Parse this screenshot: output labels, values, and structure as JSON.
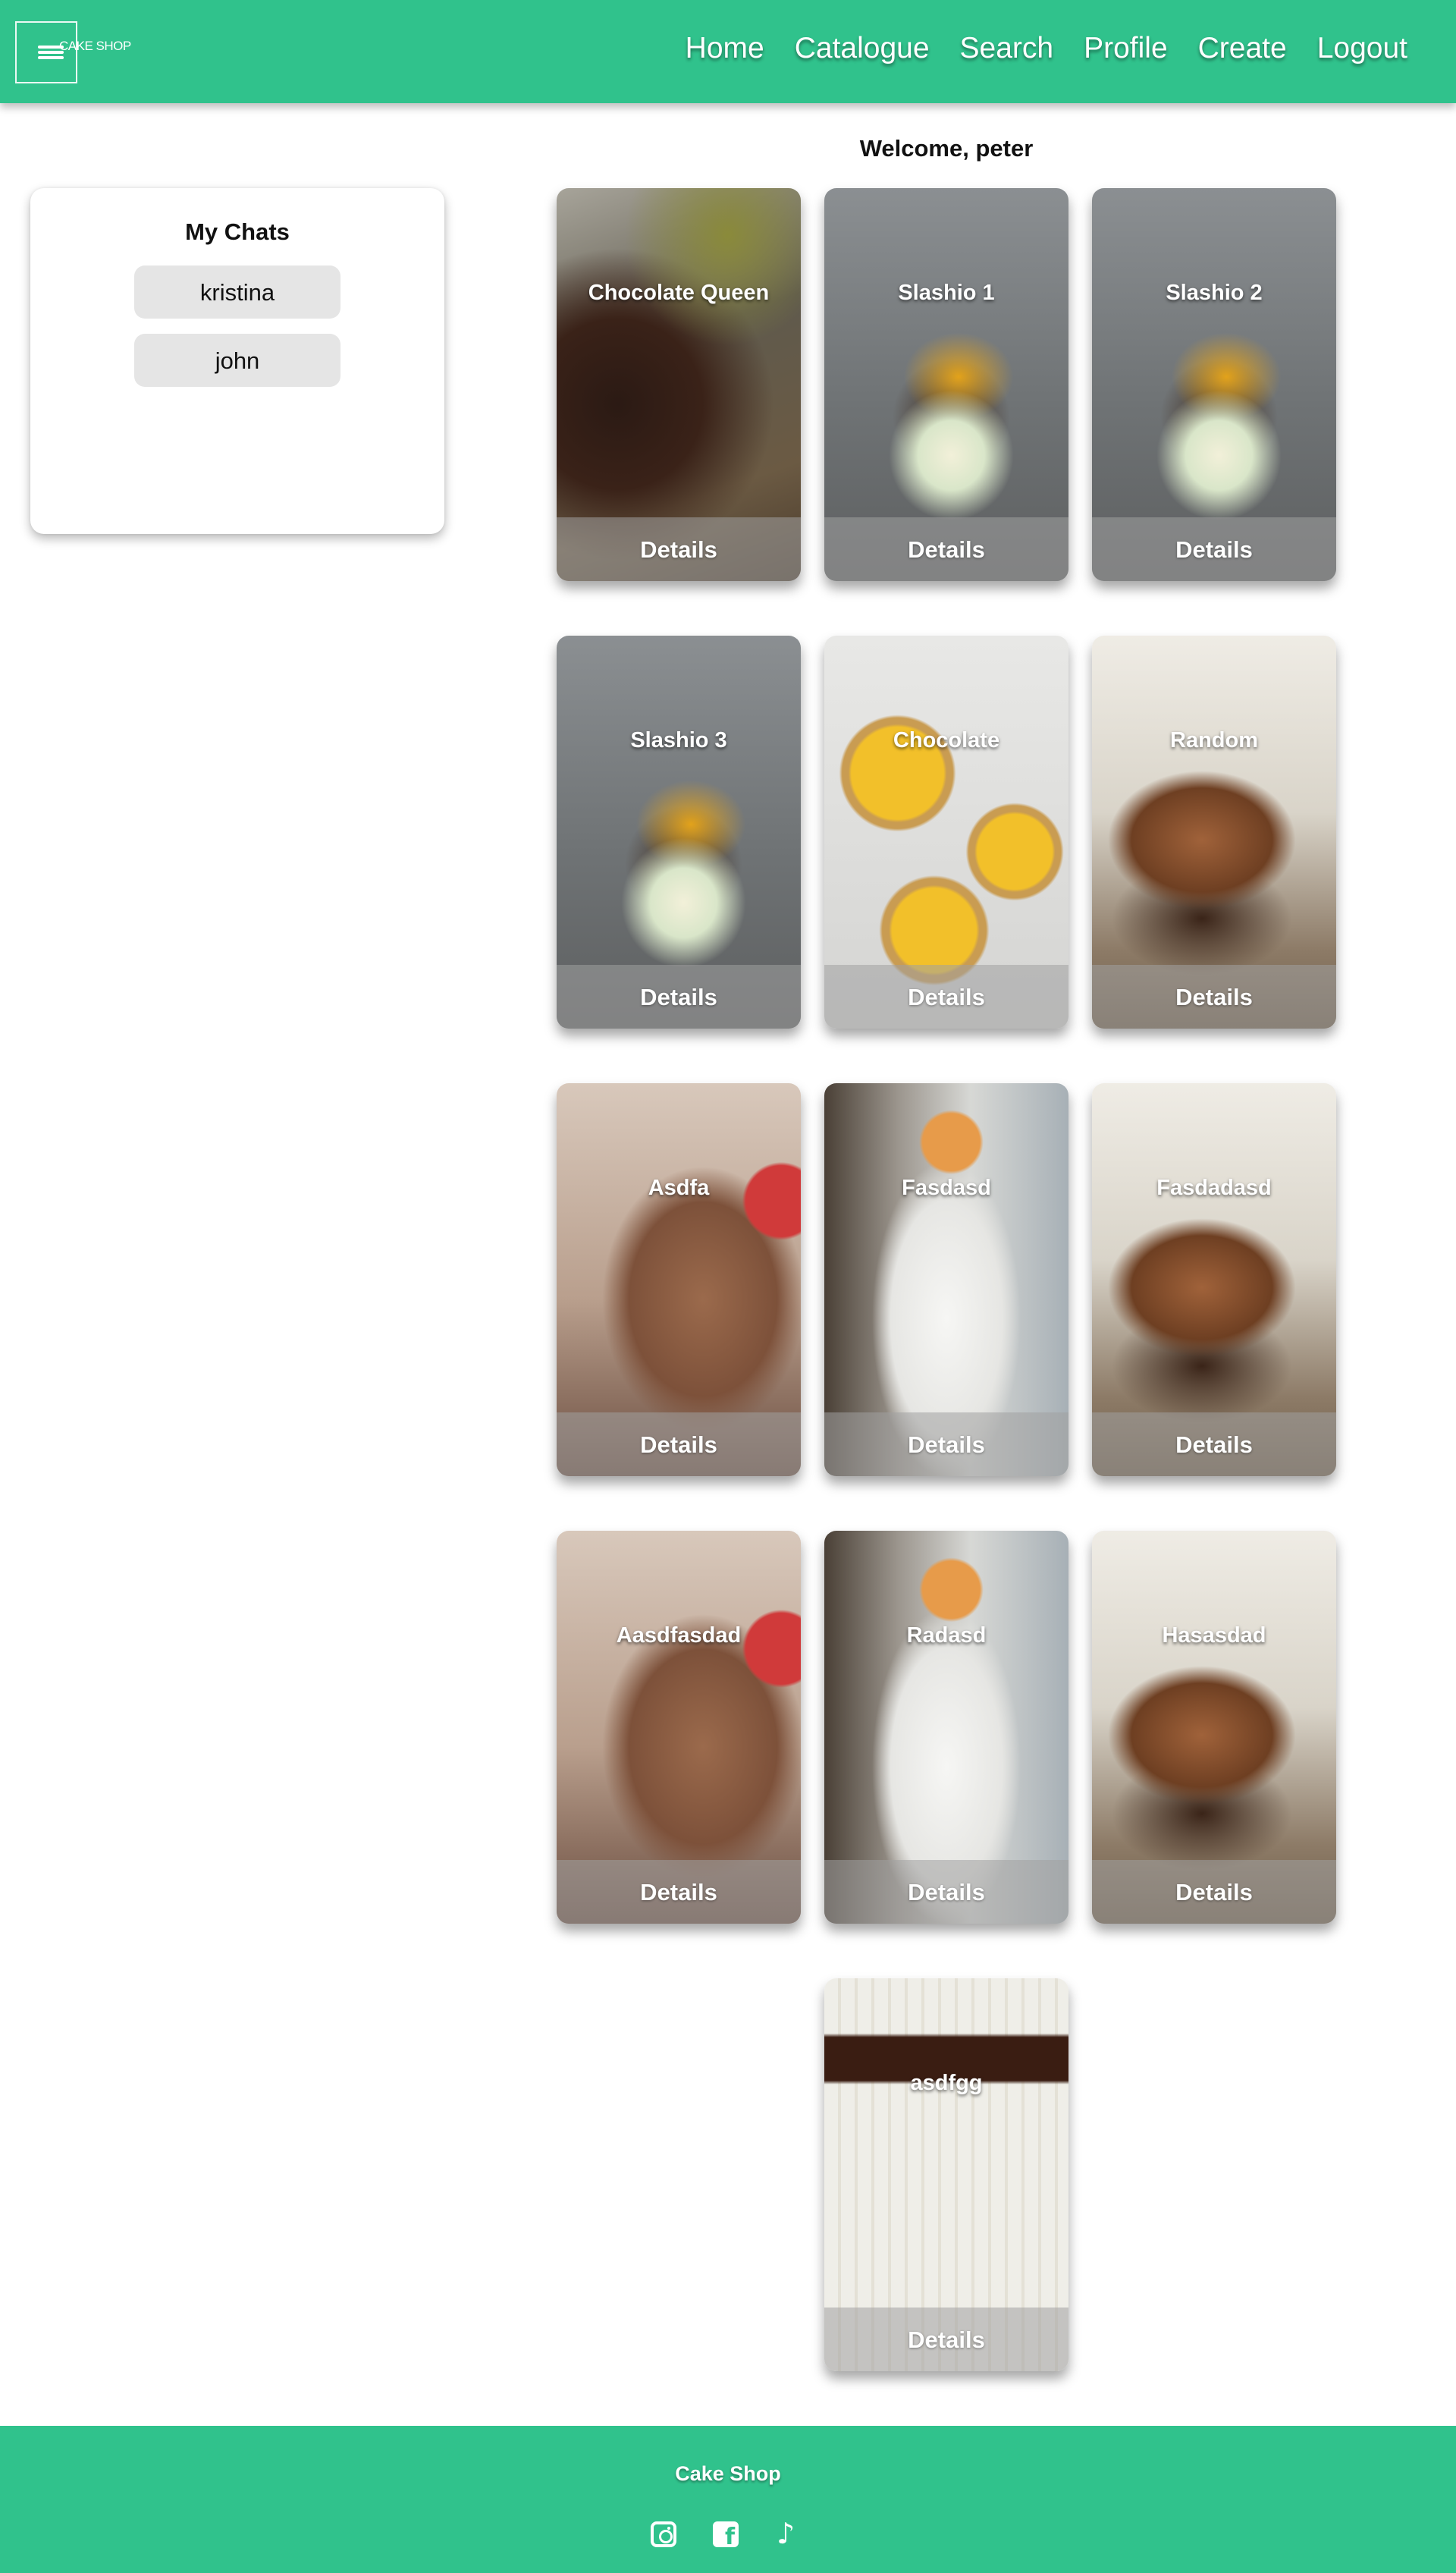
{
  "header": {
    "logo_text": "Cake Shop",
    "nav": [
      "Home",
      "Catalogue",
      "Search",
      "Profile",
      "Create",
      "Logout"
    ]
  },
  "welcome": "Welcome, peter",
  "chats": {
    "title": "My Chats",
    "items": [
      "kristina",
      "john"
    ]
  },
  "cards": [
    {
      "title": "Chocolate Queen",
      "details_label": "Details"
    },
    {
      "title": "Slashio 1",
      "details_label": "Details"
    },
    {
      "title": "Slashio 2",
      "details_label": "Details"
    },
    {
      "title": "Slashio 3",
      "details_label": "Details"
    },
    {
      "title": "Chocolate",
      "details_label": "Details"
    },
    {
      "title": "Random",
      "details_label": "Details"
    },
    {
      "title": "Asdfa",
      "details_label": "Details"
    },
    {
      "title": "Fasdasd",
      "details_label": "Details"
    },
    {
      "title": "Fasdadasd",
      "details_label": "Details"
    },
    {
      "title": "Aasdfasdad",
      "details_label": "Details"
    },
    {
      "title": "Radasd",
      "details_label": "Details"
    },
    {
      "title": "Hasasdad",
      "details_label": "Details"
    },
    {
      "title": "asdfgg",
      "details_label": "Details"
    }
  ],
  "footer": {
    "brand": "Cake Shop",
    "social_icons": [
      "instagram-icon",
      "facebook-icon",
      "tiktok-icon"
    ]
  },
  "colors": {
    "brand": "#30c28c"
  }
}
